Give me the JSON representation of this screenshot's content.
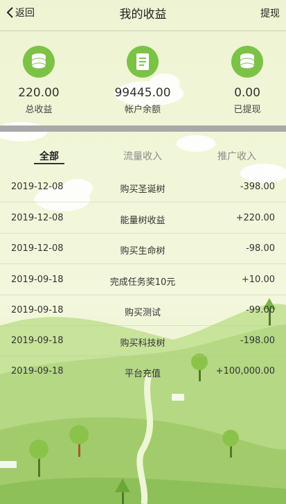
{
  "header": {
    "back_label": "返回",
    "title": "我的收益",
    "withdraw_label": "提现"
  },
  "stats": [
    {
      "value": "220.00",
      "label": "总收益",
      "icon": "coin-stack-icon"
    },
    {
      "value": "99445.00",
      "label": "帐户余额",
      "icon": "document-icon"
    },
    {
      "value": "0.00",
      "label": "已提现",
      "icon": "coin-stack-icon"
    }
  ],
  "tabs": [
    {
      "label": "全部",
      "active": true
    },
    {
      "label": "流量收入",
      "active": false
    },
    {
      "label": "推广收入",
      "active": false
    }
  ],
  "transactions": [
    {
      "date": "2019-12-08",
      "desc": "购买圣诞树",
      "amount": "-398.00"
    },
    {
      "date": "2019-12-08",
      "desc": "能量树收益",
      "amount": "+220.00"
    },
    {
      "date": "2019-12-08",
      "desc": "购买生命树",
      "amount": "-98.00"
    },
    {
      "date": "2019-09-18",
      "desc": "完成任务奖10元",
      "amount": "+10.00"
    },
    {
      "date": "2019-09-18",
      "desc": "购买测试",
      "amount": "-99.00"
    },
    {
      "date": "2019-09-18",
      "desc": "购买科技树",
      "amount": "-198.00"
    },
    {
      "date": "2019-09-18",
      "desc": "平台充值",
      "amount": "+100,000.00"
    }
  ],
  "colors": {
    "background": "#f1f6d8",
    "accent": "#7cc247",
    "hills": "#a8cf6e",
    "divider": "#a9a9a9"
  }
}
